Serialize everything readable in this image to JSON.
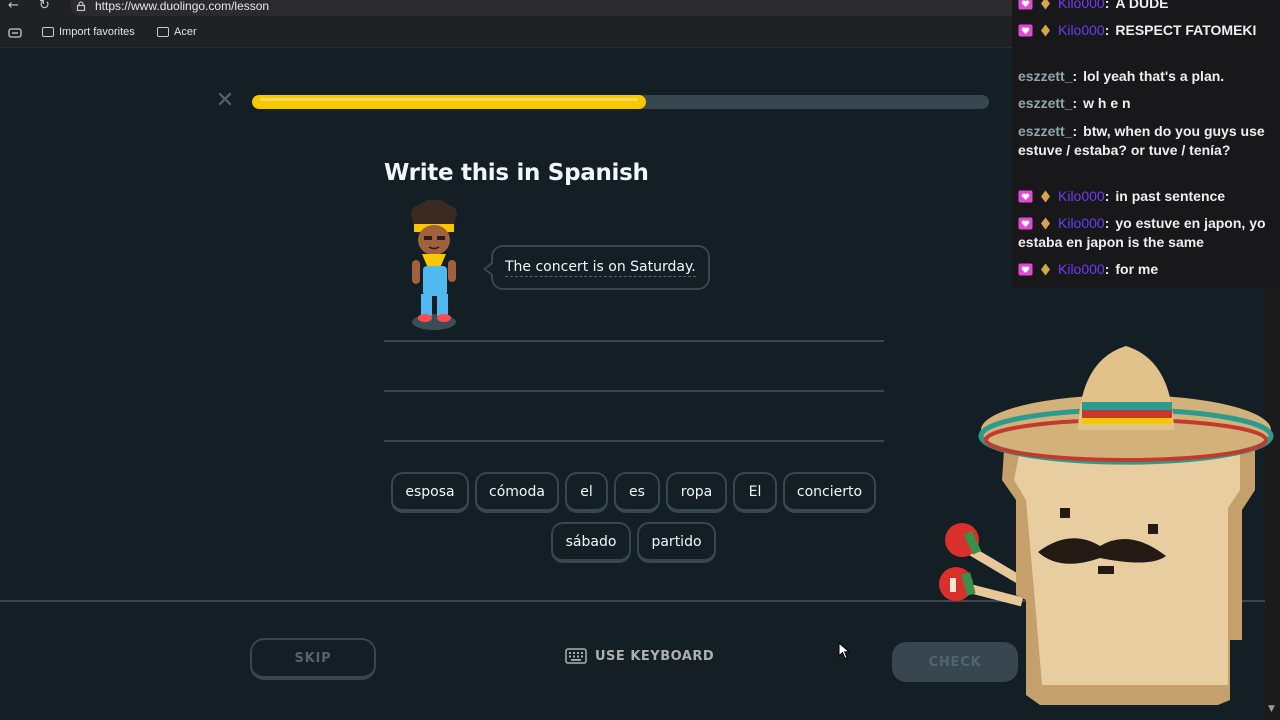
{
  "browser": {
    "url": "https://www.duolingo.com/lesson",
    "bookmarks": [
      {
        "label": "Import favorites",
        "icon": "import-favorites-icon"
      },
      {
        "label": "Acer",
        "icon": "folder-icon"
      }
    ]
  },
  "lesson": {
    "progress": 0.535,
    "title": "Write this in Spanish",
    "prompt": "The concert is on Saturday.",
    "word_bank": {
      "row1": [
        "esposa",
        "cómoda",
        "el",
        "es",
        "ropa",
        "El",
        "concierto"
      ],
      "row2": [
        "sábado",
        "partido"
      ]
    },
    "footer": {
      "skip": "SKIP",
      "keyboard": "USE KEYBOARD",
      "check": "CHECK"
    },
    "colors": {
      "background": "#131f24",
      "progress": "#f5c800",
      "border": "#37464f"
    }
  },
  "chat": {
    "messages": [
      {
        "user": "Kilo000",
        "text": "A DUDE",
        "style": "kilo"
      },
      {
        "user": "Kilo000",
        "text": "RESPECT FATOMEKI",
        "style": "kilo"
      },
      {
        "user": "eszzett_",
        "text": "lol yeah that's a plan.",
        "style": "esz"
      },
      {
        "user": "eszzett_",
        "text": "w h e n",
        "style": "esz"
      },
      {
        "user": "eszzett_",
        "text": "btw, when do you guys use estuve / estaba? or tuve / tenía?",
        "style": "esz"
      },
      {
        "user": "Kilo000",
        "text": "in past sentence",
        "style": "kilo"
      },
      {
        "user": "Kilo000",
        "text": "yo estuve en japon, yo estaba en japon is the same",
        "style": "kilo"
      },
      {
        "user": "Kilo000",
        "text": "for me",
        "style": "kilo"
      }
    ],
    "colors": {
      "kilo": "#6b3cf5",
      "esz": "#8fa7ad"
    }
  }
}
